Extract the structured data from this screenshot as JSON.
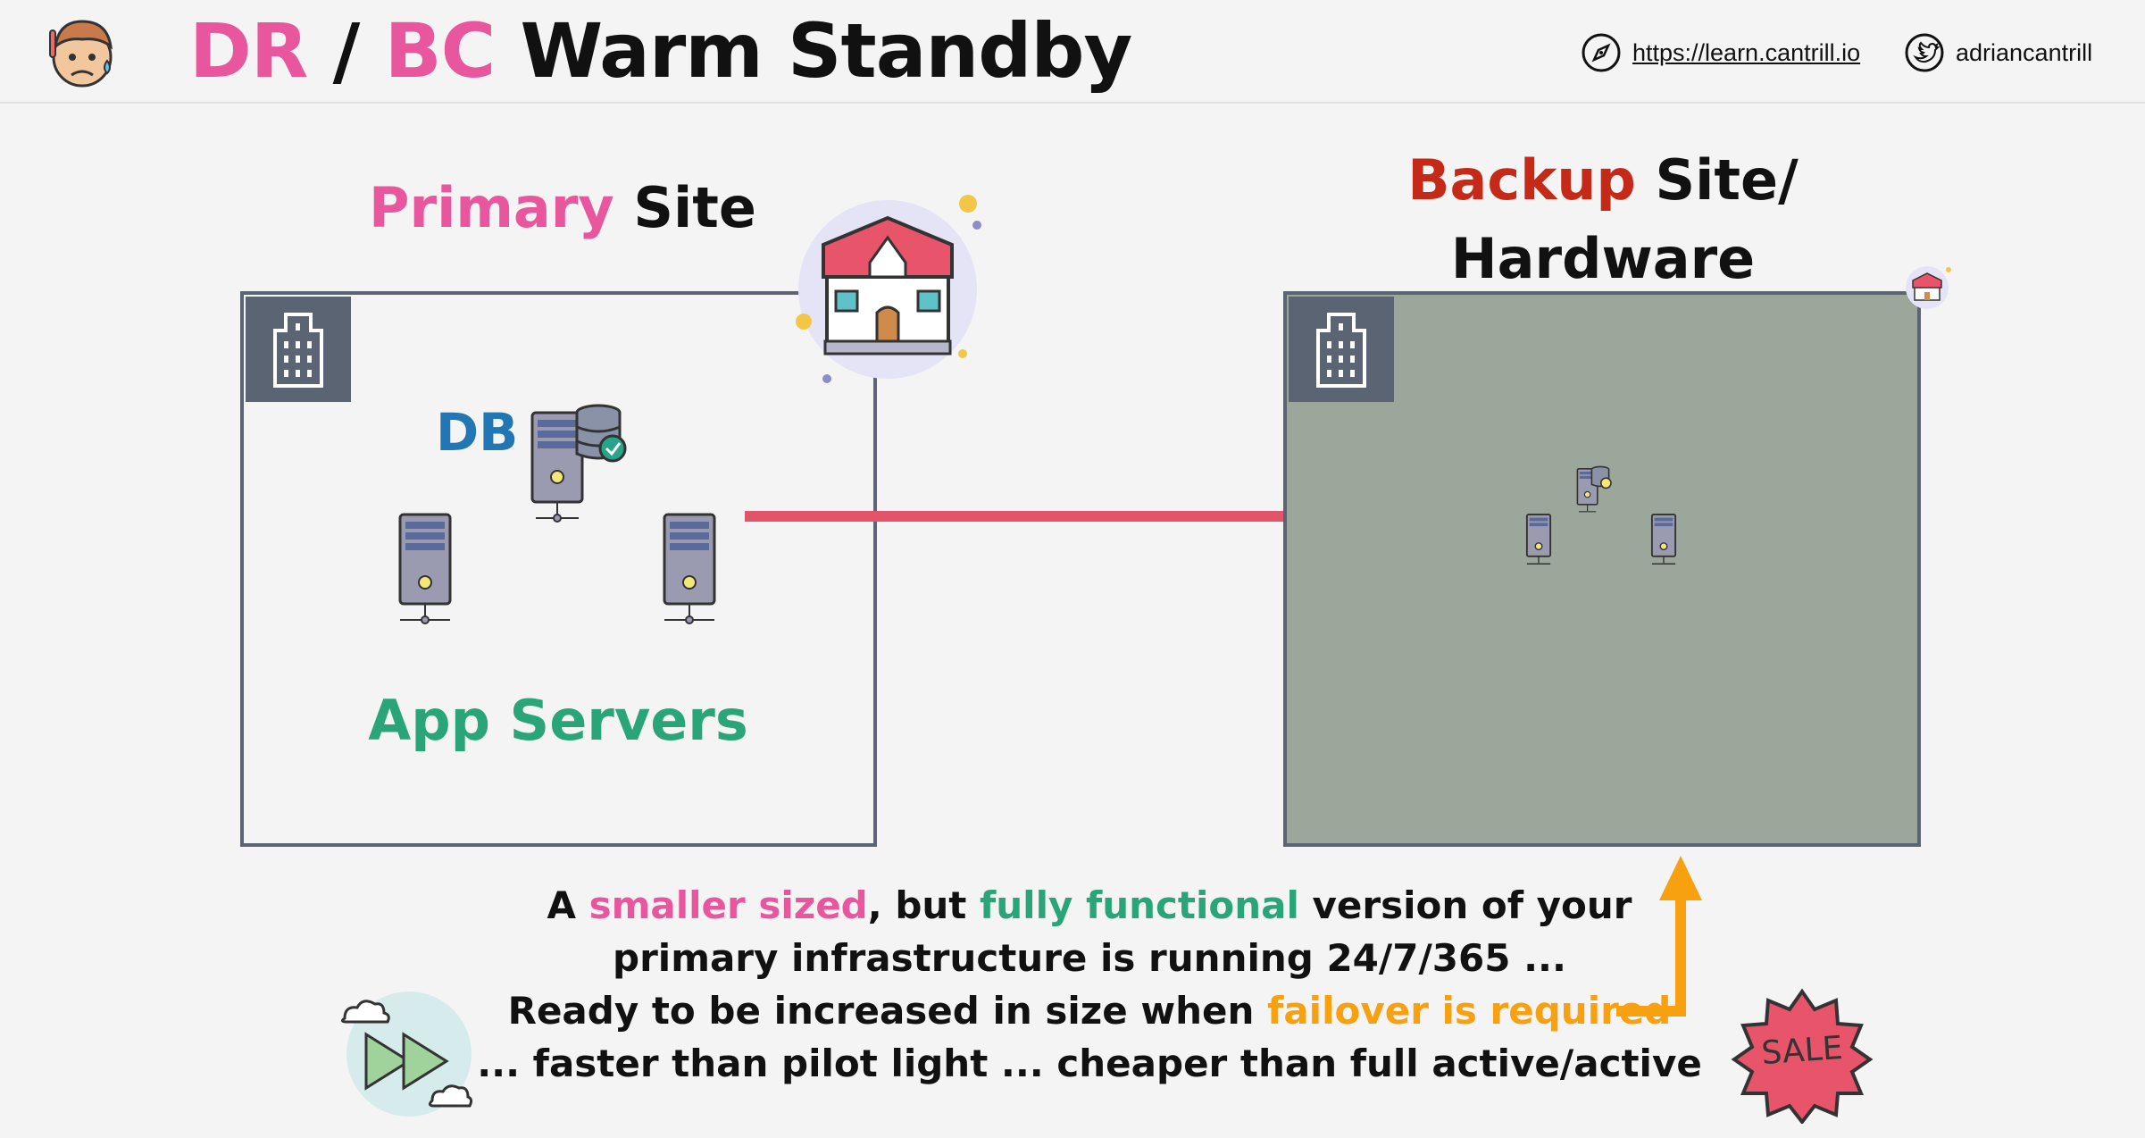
{
  "header": {
    "title_part1": "DR",
    "title_sep": " / ",
    "title_part2": "BC",
    "title_part3": " Warm Standby",
    "url": "https://learn.cantrill.io",
    "handle": "adriancantrill"
  },
  "primary": {
    "label_highlight": "Primary",
    "label_rest": " Site",
    "db_label": "DB",
    "app_label": "App Servers"
  },
  "backup": {
    "label_highlight": "Backup",
    "label_rest1": " Site/",
    "label_rest2": "Hardware"
  },
  "caption": {
    "l1_a": "A ",
    "l1_b": "smaller sized",
    "l1_c": ", but ",
    "l1_d": "fully functional",
    "l1_e": " version of your",
    "l2": "primary infrastructure is running 24/7/365 ...",
    "l3_a": "Ready to be increased in size when ",
    "l3_b": "failover is required",
    "l4": "... faster than pilot light ... cheaper than full active/active"
  },
  "sale_badge": "SALE",
  "colors": {
    "pink": "#e8579e",
    "green": "#2aa579",
    "orange": "#f7a010",
    "backup_red": "#c42a17",
    "db_blue": "#2276b4",
    "arrow_red": "#e2546a",
    "backup_fill": "#9aa79a"
  }
}
